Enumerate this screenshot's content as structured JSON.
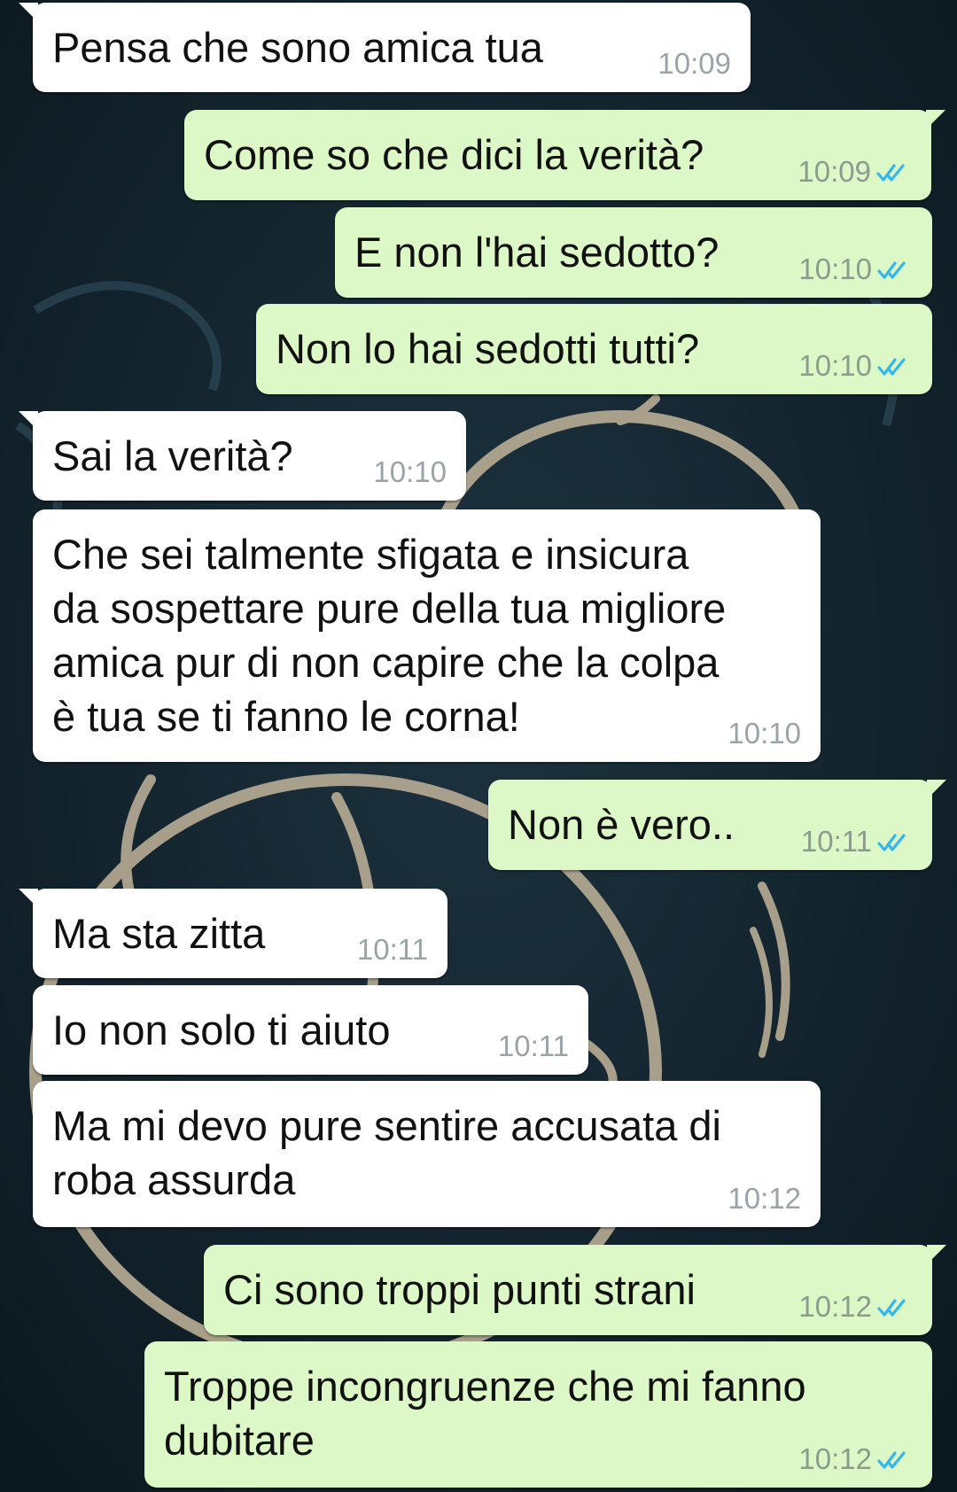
{
  "colors": {
    "incoming_bubble": "#ffffff",
    "outgoing_bubble": "#dcf8c6",
    "read_ticks": "#34b7f1",
    "wallpaper": "#12222c"
  },
  "messages": [
    {
      "dir": "in",
      "text": "Pensa che sono amica tua",
      "time": "10:09"
    },
    {
      "dir": "out",
      "text": "Come so che dici la verità?",
      "time": "10:09",
      "status": "read-ticks-icon"
    },
    {
      "dir": "out",
      "text": "E non l'hai sedotto?",
      "time": "10:10",
      "status": "read-ticks-icon"
    },
    {
      "dir": "out",
      "text": "Non lo hai sedotti tutti?",
      "time": "10:10",
      "status": "read-ticks-icon"
    },
    {
      "dir": "in",
      "text": "Sai la verità?",
      "time": "10:10"
    },
    {
      "dir": "in",
      "text": "Che sei talmente sfigata e insicura\nda sospettare pure della tua migliore\namica pur di non capire che la colpa\nè tua se ti fanno le corna!",
      "time": "10:10"
    },
    {
      "dir": "out",
      "text": "Non è vero..",
      "time": "10:11",
      "status": "read-ticks-icon"
    },
    {
      "dir": "in",
      "text": "Ma sta zitta",
      "time": "10:11"
    },
    {
      "dir": "in",
      "text": "Io non solo ti aiuto",
      "time": "10:11"
    },
    {
      "dir": "in",
      "text": "Ma mi devo pure sentire accusata di\nroba assurda",
      "time": "10:12"
    },
    {
      "dir": "out",
      "text": "Ci sono troppi punti strani",
      "time": "10:12",
      "status": "read-ticks-icon"
    },
    {
      "dir": "out",
      "text": "Troppe incongruenze che mi fanno\ndubitare",
      "time": "10:12",
      "status": "read-ticks-icon"
    }
  ]
}
